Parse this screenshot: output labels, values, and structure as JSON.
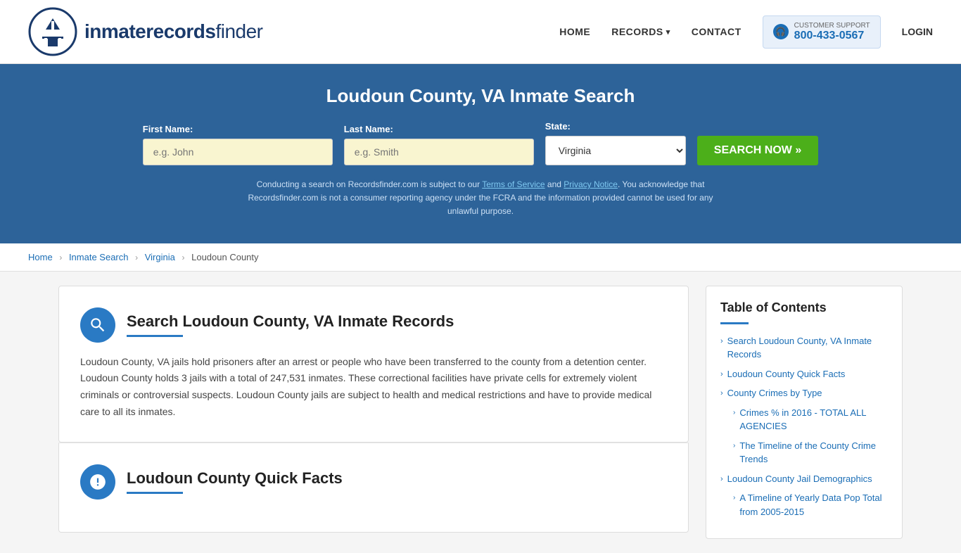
{
  "header": {
    "logo_text_light": "inmaterecords",
    "logo_text_bold": "finder",
    "nav": {
      "home": "HOME",
      "records": "RECORDS",
      "contact": "CONTACT",
      "login": "LOGIN"
    },
    "support": {
      "label": "CUSTOMER SUPPORT",
      "phone": "800-433-0567"
    }
  },
  "hero": {
    "title": "Loudoun County, VA Inmate Search",
    "form": {
      "first_name_label": "First Name:",
      "first_name_placeholder": "e.g. John",
      "last_name_label": "Last Name:",
      "last_name_placeholder": "e.g. Smith",
      "state_label": "State:",
      "state_value": "Virginia",
      "search_button": "SEARCH NOW »"
    },
    "disclaimer": "Conducting a search on Recordsfinder.com is subject to our Terms of Service and Privacy Notice. You acknowledge that Recordsfinder.com is not a consumer reporting agency under the FCRA and the information provided cannot be used for any unlawful purpose."
  },
  "breadcrumb": {
    "items": [
      "Home",
      "Inmate Search",
      "Virginia",
      "Loudoun County"
    ]
  },
  "main_card": {
    "title": "Search Loudoun County, VA Inmate Records",
    "body": "Loudoun County, VA jails hold prisoners after an arrest or people who have been transferred to the county from a detention center. Loudoun County holds 3 jails with a total of 247,531 inmates. These correctional facilities have private cells for extremely violent criminals or controversial suspects. Loudoun County jails are subject to health and medical restrictions and have to provide medical care to all its inmates."
  },
  "second_card": {
    "title": "Loudoun County Quick Facts"
  },
  "toc": {
    "title": "Table of Contents",
    "items": [
      {
        "text": "Search Loudoun County, VA Inmate Records",
        "sub": false
      },
      {
        "text": "Loudoun County Quick Facts",
        "sub": false
      },
      {
        "text": "County Crimes by Type",
        "sub": false
      },
      {
        "text": "Crimes % in 2016 - TOTAL ALL AGENCIES",
        "sub": true
      },
      {
        "text": "The Timeline of the County Crime Trends",
        "sub": true
      },
      {
        "text": "Loudoun County Jail Demographics",
        "sub": false
      },
      {
        "text": "A Timeline of Yearly Data Pop Total from 2005-2015",
        "sub": true
      }
    ]
  }
}
